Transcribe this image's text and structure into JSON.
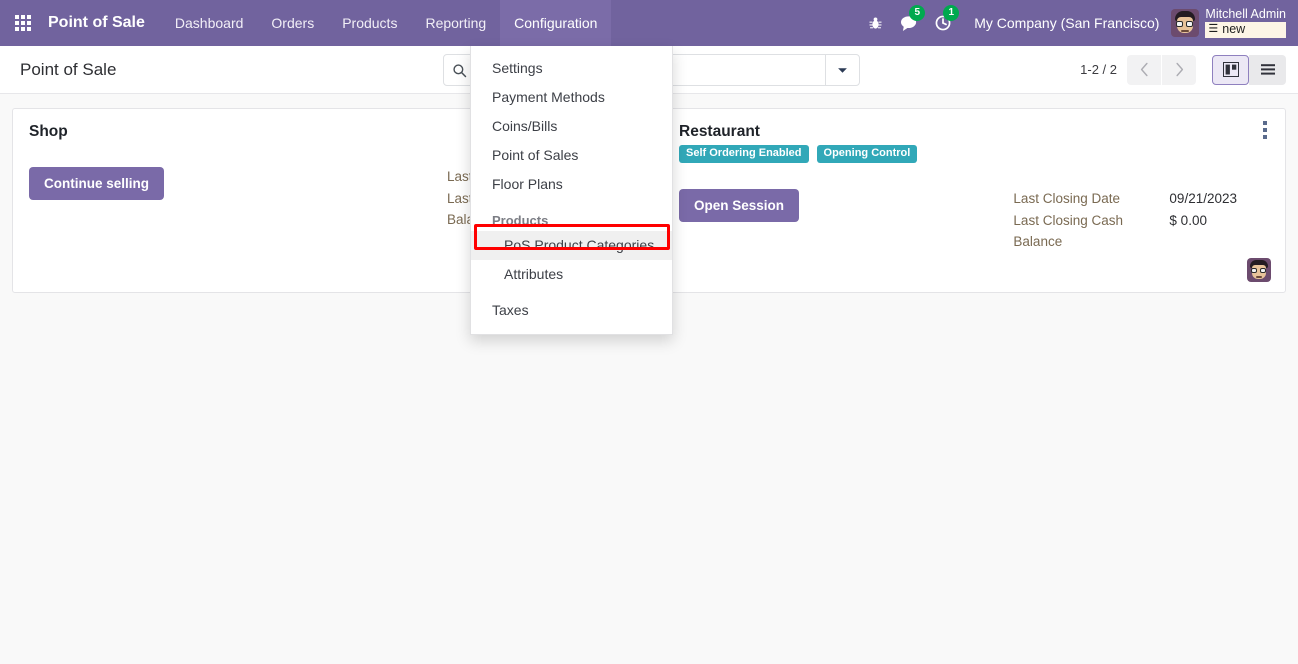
{
  "navbar": {
    "apps_icon": "grid-apps-icon",
    "brand": "Point of Sale",
    "menu_items": [
      {
        "label": "Dashboard",
        "active": false
      },
      {
        "label": "Orders",
        "active": false
      },
      {
        "label": "Products",
        "active": false
      },
      {
        "label": "Reporting",
        "active": false
      },
      {
        "label": "Configuration",
        "active": true
      }
    ],
    "bug_icon": "bug-icon",
    "messages_icon": "chat-bubble-icon",
    "messages_count": "5",
    "activities_icon": "clock-activity-icon",
    "activities_count": "1",
    "company": "My Company (San Francisco)",
    "user_name": "Mitchell Admin",
    "db_icon": "database-icon",
    "db_name": "new",
    "accent_color": "#71639e",
    "badge_color": "#00a94f"
  },
  "control_panel": {
    "breadcrumb": "Point of Sale",
    "search_icon": "search-icon",
    "search_value": "",
    "search_placeholder": "",
    "search_toggle_icon": "chevron-down-icon",
    "pager": "1-2 / 2",
    "prev_icon": "chevron-left-icon",
    "next_icon": "chevron-right-icon",
    "views": [
      {
        "name": "kanban",
        "icon": "kanban-view-icon",
        "active": true
      },
      {
        "name": "list",
        "icon": "list-view-icon",
        "active": false
      }
    ]
  },
  "dropdown": {
    "open_for": "Configuration",
    "items": [
      {
        "label": "Settings",
        "type": "item"
      },
      {
        "label": "Payment Methods",
        "type": "item"
      },
      {
        "label": "Coins/Bills",
        "type": "item"
      },
      {
        "label": "Point of Sales",
        "type": "item"
      },
      {
        "label": "Floor Plans",
        "type": "item"
      },
      {
        "label": "Products",
        "type": "section"
      },
      {
        "label": "PoS Product Categories",
        "type": "sub",
        "highlighted": true
      },
      {
        "label": "Attributes",
        "type": "sub"
      },
      {
        "label": "Taxes",
        "type": "item"
      }
    ],
    "highlight_color": "#ff0000"
  },
  "kanban": {
    "cards": [
      {
        "title": "Shop",
        "badges": [],
        "button_label": "Continue selling",
        "stats": [
          {
            "label": "Last Closing Date",
            "value": ""
          },
          {
            "label": "Last Closing Cash Balance",
            "value": ""
          }
        ],
        "has_avatar": false,
        "has_menu": false
      },
      {
        "title": "Restaurant",
        "badges": [
          "Self Ordering Enabled",
          "Opening Control"
        ],
        "button_label": "Open Session",
        "stats": [
          {
            "label": "Last Closing Date",
            "value": "09/21/2023"
          },
          {
            "label": "Last Closing Cash Balance",
            "value": "$ 0.00"
          }
        ],
        "has_avatar": true,
        "has_menu": true,
        "menu_icon": "vertical-dots-icon",
        "avatar_icon": "user-avatar"
      }
    ],
    "badge_color": "#31a8b8",
    "button_color": "#7a6aa8"
  }
}
